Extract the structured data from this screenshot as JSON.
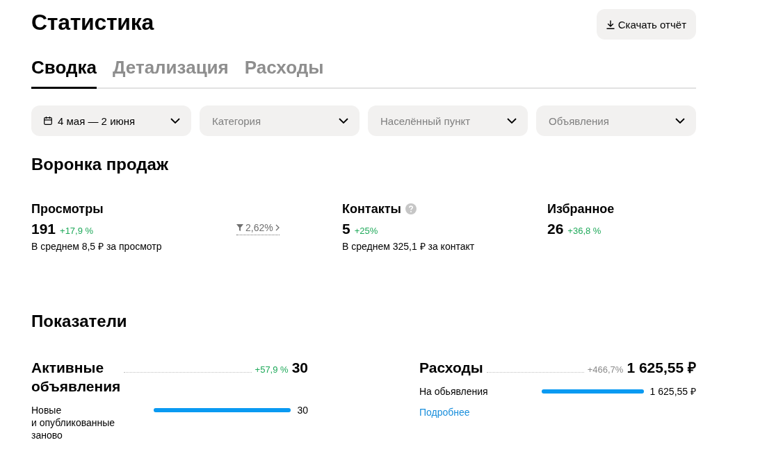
{
  "page": {
    "title": "Статистика",
    "download_button": {
      "label": "Скачать отчёт"
    }
  },
  "tabs": [
    {
      "label": "Сводка",
      "selected": true
    },
    {
      "label": "Детализация",
      "selected": false
    },
    {
      "label": "Расходы",
      "selected": false
    }
  ],
  "filters": [
    {
      "kind": "date",
      "value": "4 мая — 2 июня"
    },
    {
      "kind": "select",
      "placeholder": "Категория"
    },
    {
      "kind": "select",
      "placeholder": "Населённый пункт"
    },
    {
      "kind": "select",
      "placeholder": "Объявления"
    }
  ],
  "funnel": {
    "title": "Воронка продаж",
    "stages": [
      {
        "label": "Просмотры",
        "help": false,
        "value": "191",
        "delta": {
          "text": "+17,9 %",
          "favorable": true
        },
        "average": "В среднем 8,5 ₽ за просмотр",
        "conversion": "2,62%"
      },
      {
        "label": "Контакты",
        "help": true,
        "value": "5",
        "delta": {
          "text": "+25%",
          "favorable": true
        },
        "average": "В среднем 325,1 ₽ за контакт"
      },
      {
        "label": "Избранное",
        "help": false,
        "value": "26",
        "delta": {
          "text": "+36,8 %",
          "favorable": true
        }
      }
    ]
  },
  "metrics": {
    "title": "Показатели",
    "cards": [
      {
        "title": "Активные объявления",
        "delta": {
          "text": "+57,9 %",
          "favorable": true
        },
        "value": "30",
        "rows": [
          {
            "label": "Новые и опубликованные заново",
            "level": 1,
            "value": "30"
          }
        ]
      },
      {
        "title": "Расходы",
        "delta": {
          "text": "+466,7%",
          "favorable": false
        },
        "value": "1 625,55 ₽",
        "rows": [
          {
            "label": "На обьявления",
            "level": 1,
            "value": "1 625,55 ₽"
          }
        ],
        "link": "Подробнее"
      }
    ]
  }
}
